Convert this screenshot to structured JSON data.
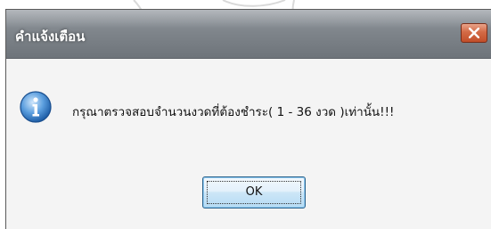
{
  "dialog": {
    "title": "คำแจ้งเตือน",
    "message": "กรุณาตรวจสอบจำนวนงวดที่ต้องชำระ( 1 - 36 งวด )เท่านั้น!!!",
    "ok_label": "OK",
    "icon": "info-icon",
    "close_icon": "close-icon"
  },
  "colors": {
    "titlebar": "#7f858b",
    "close_button": "#c24f2a",
    "info_icon": "#2a6fb8",
    "ok_button_border": "#2c628b"
  }
}
